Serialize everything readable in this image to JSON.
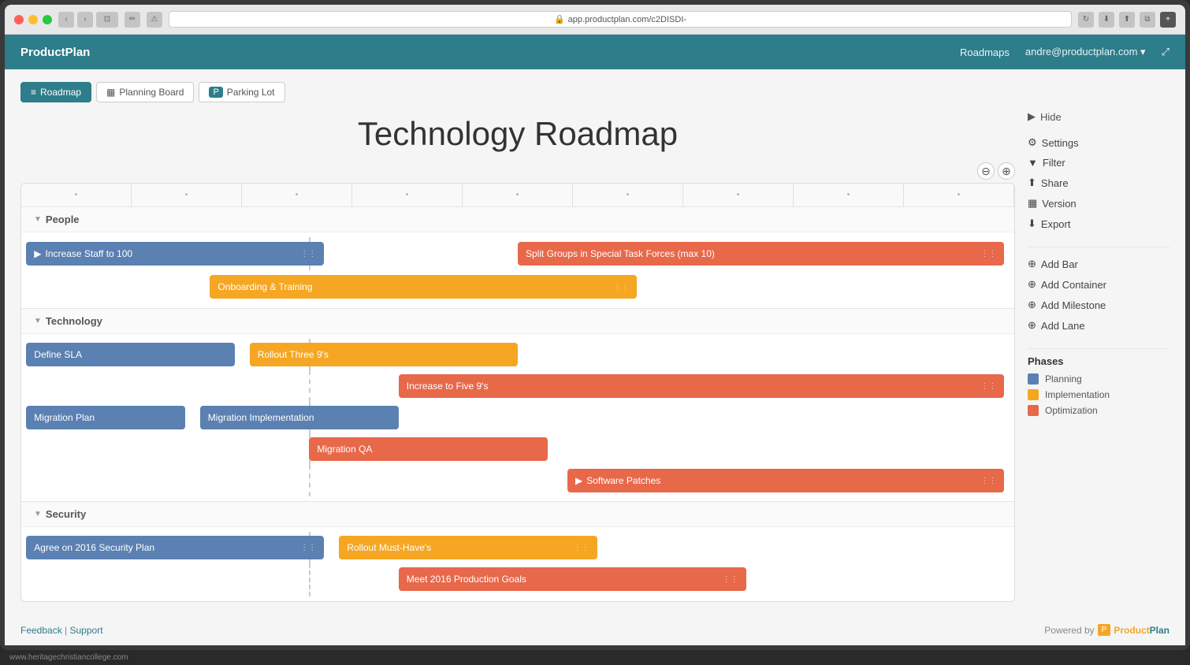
{
  "browser": {
    "url": "app.productplan.com/c2DISDI-",
    "back_label": "‹",
    "forward_label": "›"
  },
  "header": {
    "logo": "ProductPlan",
    "nav_roadmaps": "Roadmaps",
    "user_email": "andre@productplan.com ▾",
    "fullscreen_icon": "⤢"
  },
  "tabs": [
    {
      "label": "Roadmap",
      "icon": "≡",
      "active": true
    },
    {
      "label": "Planning Board",
      "icon": "▦",
      "active": false
    },
    {
      "label": "Parking Lot",
      "icon": "P",
      "active": false
    }
  ],
  "page_title": "Technology Roadmap",
  "sidebar": {
    "hide_label": "Hide",
    "settings_label": "Settings",
    "filter_label": "Filter",
    "share_label": "Share",
    "version_label": "Version",
    "export_label": "Export",
    "add_bar_label": "Add Bar",
    "add_container_label": "Add Container",
    "add_milestone_label": "Add Milestone",
    "add_lane_label": "Add Lane",
    "phases_label": "Phases",
    "phases": [
      {
        "label": "Planning",
        "color": "#5b80b2"
      },
      {
        "label": "Implementation",
        "color": "#f5a623"
      },
      {
        "label": "Optimization",
        "color": "#e8684a"
      }
    ]
  },
  "lanes": [
    {
      "name": "People",
      "rows": [
        {
          "bars": [
            {
              "label": "Increase Staff to 100",
              "type": "blue",
              "left_pct": 0,
              "width_pct": 31,
              "has_chevron": true,
              "has_expand": true
            },
            {
              "label": "Split Groups in Special Task Forces (max 10)",
              "type": "orange",
              "left_pct": 50,
              "width_pct": 50,
              "has_expand": true
            }
          ]
        },
        {
          "bars": [
            {
              "label": "Onboarding & Training",
              "type": "yellow",
              "left_pct": 19,
              "width_pct": 43,
              "has_expand": true
            }
          ]
        }
      ]
    },
    {
      "name": "Technology",
      "rows": [
        {
          "bars": [
            {
              "label": "Define SLA",
              "type": "blue",
              "left_pct": 0,
              "width_pct": 22,
              "has_expand": false
            },
            {
              "label": "Rollout Three 9's",
              "type": "yellow",
              "left_pct": 24,
              "width_pct": 28,
              "has_expand": false
            }
          ]
        },
        {
          "bars": [
            {
              "label": "Increase to Five 9's",
              "type": "orange",
              "left_pct": 38,
              "width_pct": 62,
              "has_expand": true
            }
          ]
        },
        {
          "bars": [
            {
              "label": "Migration Plan",
              "type": "blue",
              "left_pct": 0,
              "width_pct": 17,
              "has_expand": false
            },
            {
              "label": "Migration Implementation",
              "type": "blue",
              "left_pct": 18,
              "width_pct": 21,
              "has_expand": false
            }
          ]
        },
        {
          "bars": [
            {
              "label": "Migration QA",
              "type": "orange",
              "left_pct": 29,
              "width_pct": 24,
              "has_expand": false
            }
          ]
        },
        {
          "bars": [
            {
              "label": "Software Patches",
              "type": "orange",
              "left_pct": 56,
              "width_pct": 44,
              "has_chevron": true,
              "has_expand": true
            }
          ]
        }
      ]
    },
    {
      "name": "Security",
      "rows": [
        {
          "bars": [
            {
              "label": "Agree on 2016 Security Plan",
              "type": "blue",
              "left_pct": 0,
              "width_pct": 31,
              "has_expand": true
            },
            {
              "label": "Rollout Must-Have's",
              "type": "yellow",
              "left_pct": 32,
              "width_pct": 28,
              "has_expand": true
            }
          ]
        },
        {
          "bars": [
            {
              "label": "Meet 2016 Production Goals",
              "type": "orange",
              "left_pct": 38,
              "width_pct": 36,
              "has_expand": true
            }
          ]
        }
      ]
    }
  ],
  "footer": {
    "feedback": "Feedback",
    "support": "Support",
    "powered_by": "Powered by",
    "brand": "ProductPlan"
  }
}
